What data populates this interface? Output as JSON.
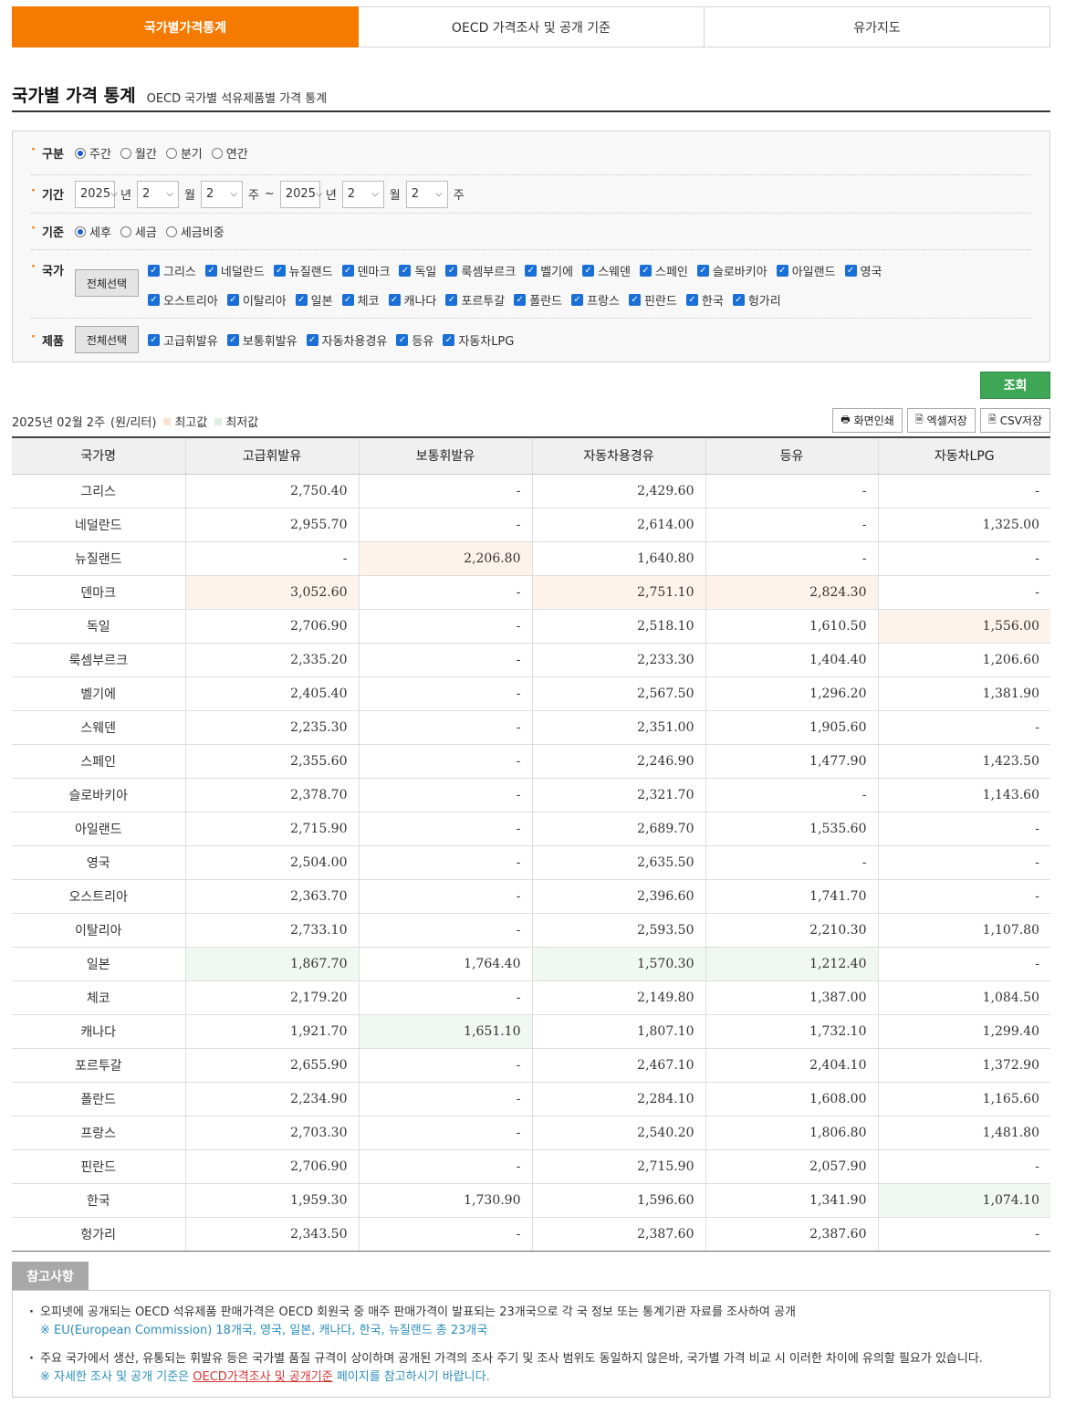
{
  "tabs": [
    "국가별가격통계",
    "OECD 가격조사 및 공개 기준",
    "유가지도"
  ],
  "header": {
    "title": "국가별 가격 통계",
    "subtitle": "OECD 국가별 석유제품별 가격 통계"
  },
  "filter": {
    "gubun": {
      "label": "구분",
      "options": [
        "주간",
        "월간",
        "분기",
        "연간"
      ],
      "selected": "주간"
    },
    "period": {
      "label": "기간",
      "from": {
        "year": "2025",
        "month": "2",
        "week": "2"
      },
      "to": {
        "year": "2025",
        "month": "2",
        "week": "2"
      },
      "unit_year": "년",
      "unit_month": "월",
      "unit_week": "주",
      "sep": "~"
    },
    "basis": {
      "label": "기준",
      "options": [
        "세후",
        "세금",
        "세금비중"
      ],
      "selected": "세후"
    },
    "country": {
      "label": "국가",
      "select_all": "전체선택",
      "line1": [
        "그리스",
        "네덜란드",
        "뉴질랜드",
        "덴마크",
        "독일",
        "룩셈부르크",
        "벨기에",
        "스웨덴",
        "스페인",
        "슬로바키아",
        "아일랜드",
        "영국"
      ],
      "line2": [
        "오스트리아",
        "이탈리아",
        "일본",
        "체코",
        "캐나다",
        "포르투갈",
        "폴란드",
        "프랑스",
        "핀란드",
        "한국",
        "헝가리"
      ]
    },
    "product": {
      "label": "제품",
      "select_all": "전체선택",
      "items": [
        "고급휘발유",
        "보통휘발유",
        "자동차용경유",
        "등유",
        "자동차LPG"
      ]
    }
  },
  "query_button": "조회",
  "info": {
    "period_text": "2025년 02월 2주",
    "unit": "(원/리터)",
    "legend_max": "최고값",
    "legend_min": "최저값",
    "color_max": "#fbe3cf",
    "color_min": "#dcefe0"
  },
  "tools": [
    "화면인쇄",
    "엑셀저장",
    "CSV저장"
  ],
  "table": {
    "headers": [
      "국가명",
      "고급휘발유",
      "보통휘발유",
      "자동차용경유",
      "등유",
      "자동차LPG"
    ],
    "rows": [
      {
        "cells": [
          "그리스",
          "2,750.40",
          "-",
          "2,429.60",
          "-",
          "-"
        ],
        "hl": [
          "",
          "",
          "",
          "",
          "",
          ""
        ]
      },
      {
        "cells": [
          "네덜란드",
          "2,955.70",
          "-",
          "2,614.00",
          "-",
          "1,325.00"
        ],
        "hl": [
          "",
          "",
          "",
          "",
          "",
          ""
        ]
      },
      {
        "cells": [
          "뉴질랜드",
          "-",
          "2,206.80",
          "1,640.80",
          "-",
          "-"
        ],
        "hl": [
          "",
          "",
          "max",
          "",
          "",
          ""
        ]
      },
      {
        "cells": [
          "덴마크",
          "3,052.60",
          "-",
          "2,751.10",
          "2,824.30",
          "-"
        ],
        "hl": [
          "",
          "max",
          "",
          "max",
          "max",
          ""
        ]
      },
      {
        "cells": [
          "독일",
          "2,706.90",
          "-",
          "2,518.10",
          "1,610.50",
          "1,556.00"
        ],
        "hl": [
          "",
          "",
          "",
          "",
          "",
          "max"
        ]
      },
      {
        "cells": [
          "룩셈부르크",
          "2,335.20",
          "-",
          "2,233.30",
          "1,404.40",
          "1,206.60"
        ],
        "hl": [
          "",
          "",
          "",
          "",
          "",
          ""
        ]
      },
      {
        "cells": [
          "벨기에",
          "2,405.40",
          "-",
          "2,567.50",
          "1,296.20",
          "1,381.90"
        ],
        "hl": [
          "",
          "",
          "",
          "",
          "",
          ""
        ]
      },
      {
        "cells": [
          "스웨덴",
          "2,235.30",
          "-",
          "2,351.00",
          "1,905.60",
          "-"
        ],
        "hl": [
          "",
          "",
          "",
          "",
          "",
          ""
        ]
      },
      {
        "cells": [
          "스페인",
          "2,355.60",
          "-",
          "2,246.90",
          "1,477.90",
          "1,423.50"
        ],
        "hl": [
          "",
          "",
          "",
          "",
          "",
          ""
        ]
      },
      {
        "cells": [
          "슬로바키아",
          "2,378.70",
          "-",
          "2,321.70",
          "-",
          "1,143.60"
        ],
        "hl": [
          "",
          "",
          "",
          "",
          "",
          ""
        ]
      },
      {
        "cells": [
          "아일랜드",
          "2,715.90",
          "-",
          "2,689.70",
          "1,535.60",
          "-"
        ],
        "hl": [
          "",
          "",
          "",
          "",
          "",
          ""
        ]
      },
      {
        "cells": [
          "영국",
          "2,504.00",
          "-",
          "2,635.50",
          "-",
          "-"
        ],
        "hl": [
          "",
          "",
          "",
          "",
          "",
          ""
        ]
      },
      {
        "cells": [
          "오스트리아",
          "2,363.70",
          "-",
          "2,396.60",
          "1,741.70",
          "-"
        ],
        "hl": [
          "",
          "",
          "",
          "",
          "",
          ""
        ]
      },
      {
        "cells": [
          "이탈리아",
          "2,733.10",
          "-",
          "2,593.50",
          "2,210.30",
          "1,107.80"
        ],
        "hl": [
          "",
          "",
          "",
          "",
          "",
          ""
        ]
      },
      {
        "cells": [
          "일본",
          "1,867.70",
          "1,764.40",
          "1,570.30",
          "1,212.40",
          "-"
        ],
        "hl": [
          "",
          "min",
          "",
          "min",
          "min",
          ""
        ]
      },
      {
        "cells": [
          "체코",
          "2,179.20",
          "-",
          "2,149.80",
          "1,387.00",
          "1,084.50"
        ],
        "hl": [
          "",
          "",
          "",
          "",
          "",
          ""
        ]
      },
      {
        "cells": [
          "캐나다",
          "1,921.70",
          "1,651.10",
          "1,807.10",
          "1,732.10",
          "1,299.40"
        ],
        "hl": [
          "",
          "",
          "min",
          "",
          "",
          ""
        ]
      },
      {
        "cells": [
          "포르투갈",
          "2,655.90",
          "-",
          "2,467.10",
          "2,404.10",
          "1,372.90"
        ],
        "hl": [
          "",
          "",
          "",
          "",
          "",
          ""
        ]
      },
      {
        "cells": [
          "폴란드",
          "2,234.90",
          "-",
          "2,284.10",
          "1,608.00",
          "1,165.60"
        ],
        "hl": [
          "",
          "",
          "",
          "",
          "",
          ""
        ]
      },
      {
        "cells": [
          "프랑스",
          "2,703.30",
          "-",
          "2,540.20",
          "1,806.80",
          "1,481.80"
        ],
        "hl": [
          "",
          "",
          "",
          "",
          "",
          ""
        ]
      },
      {
        "cells": [
          "핀란드",
          "2,706.90",
          "-",
          "2,715.90",
          "2,057.90",
          "-"
        ],
        "hl": [
          "",
          "",
          "",
          "",
          "",
          ""
        ]
      },
      {
        "cells": [
          "한국",
          "1,959.30",
          "1,730.90",
          "1,596.60",
          "1,341.90",
          "1,074.10"
        ],
        "hl": [
          "",
          "",
          "",
          "",
          "",
          "min"
        ]
      },
      {
        "cells": [
          "헝가리",
          "2,343.50",
          "-",
          "2,387.60",
          "2,387.60",
          "-"
        ],
        "hl": [
          "",
          "",
          "",
          "",
          "",
          ""
        ]
      }
    ]
  },
  "notes": {
    "tag": "참고사항",
    "item1": "오피넷에 공개되는 OECD 석유제품 판매가격은 OECD 회원국 중 매주 판매가격이 발표되는 23개국으로 각 국 정보 또는 통계기관 자료를 조사하여 공개",
    "item1_sub": "※ EU(European Commission) 18개국, 영국, 일본, 캐나다, 한국, 뉴질랜드 총 23개국",
    "item2": "주요 국가에서 생산, 유통되는 휘발유 등은 국가별 품질 규격이 상이하며 공개된 가격의 조사 주기 및 조사 범위도 동일하지 않은바, 국가별 가격 비교 시 이러한 차이에 유의할 필요가 있습니다.",
    "item2_sub_pre": "※ 자세한 조사 및 공개 기준은 ",
    "item2_sub_link": "OECD가격조사 및 공개기준",
    "item2_sub_post": " 페이지를 참고하시기 바랍니다."
  }
}
